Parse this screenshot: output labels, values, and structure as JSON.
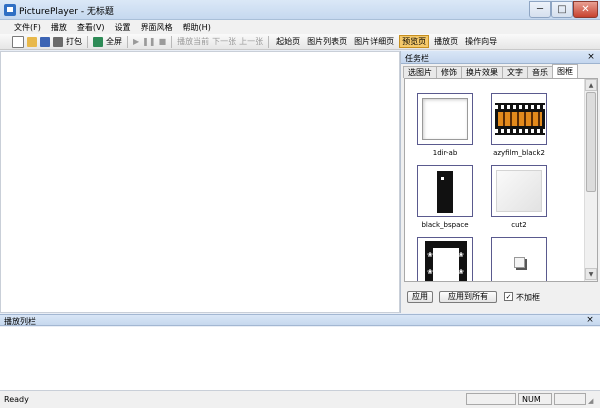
{
  "window": {
    "title": "PicturePlayer - 无标题",
    "min": "─",
    "max": "□",
    "close": "✕",
    "colors": {
      "titlebar": "#c5d8ef",
      "close": "#c7422f"
    }
  },
  "menu": [
    "文件(F)",
    "播放",
    "查看(V)",
    "设置",
    "界面风格",
    "帮助(H)"
  ],
  "toolbar": {
    "print_label": "打包",
    "fullscreen_label": "全屏",
    "play_current": "播放当前",
    "next": "下一张",
    "prev": "上一张",
    "pages": [
      "起始页",
      "图片列表页",
      "图片详细页",
      "预览页",
      "播放页",
      "操作向导"
    ],
    "active_page": "预览页"
  },
  "taskpane": {
    "title": "任务栏",
    "close": "×",
    "tabs": [
      "选图片",
      "修饰",
      "换片效果",
      "文字",
      "音乐",
      "图框"
    ],
    "active_tab": "图框",
    "items": [
      {
        "label": "1dir-ab",
        "icon": "dir-frame-thumb"
      },
      {
        "label": "azyfilm_black2",
        "icon": "filmstrip-thumb"
      },
      {
        "label": "black_bspace",
        "icon": "black-frame-thumb"
      },
      {
        "label": "cut2",
        "icon": "cut-frame-thumb"
      },
      {
        "label": "",
        "icon": "paw-print-thumb"
      },
      {
        "label": "",
        "icon": "cube-frame-thumb"
      }
    ],
    "apply_label": "应用",
    "apply_all_label": "应用到所有",
    "no_frame_label": "不加框",
    "no_frame_checked": "✓"
  },
  "playlist": {
    "title": "播放列栏",
    "close": "×"
  },
  "status": {
    "text": "Ready",
    "num": "NUM"
  }
}
